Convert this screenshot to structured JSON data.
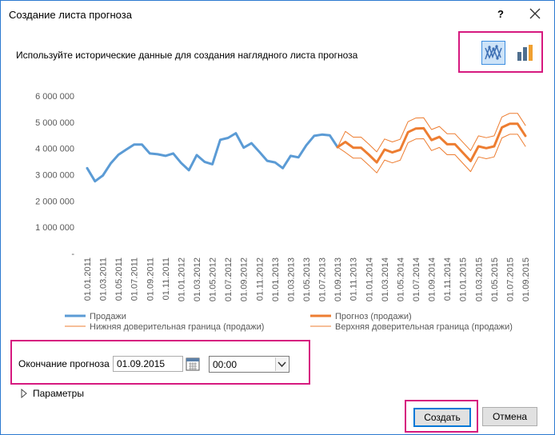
{
  "dialog": {
    "title": "Создание листа прогноза",
    "help_label": "?",
    "instruction": "Используйте исторические данные для создания наглядного листа прогноза",
    "chart_types": [
      "line-chart-icon",
      "column-chart-icon"
    ],
    "selected_chart_type": "line-chart-icon"
  },
  "forecast_end": {
    "label": "Окончание прогноза",
    "date_value": "01.09.2015",
    "time_value": "00:00"
  },
  "params": {
    "label": "Параметры"
  },
  "buttons": {
    "create": "Создать",
    "cancel": "Отмена"
  },
  "colors": {
    "actual": "#5b9bd5",
    "forecast": "#ed7d31",
    "highlight": "#d6197f",
    "accent": "#0078d7"
  },
  "chart_data": {
    "type": "line",
    "ylim": [
      0,
      6000000
    ],
    "yticks": [
      "-",
      "1 000 000",
      "2 000 000",
      "3 000 000",
      "4 000 000",
      "5 000 000",
      "6 000 000"
    ],
    "xticks": [
      "01.01.2011",
      "01.03.2011",
      "01.05.2011",
      "01.07.2011",
      "01.09.2011",
      "01.11.2011",
      "01.01.2012",
      "01.03.2012",
      "01.05.2012",
      "01.07.2012",
      "01.09.2012",
      "01.11.2012",
      "01.01.2013",
      "01.03.2013",
      "01.05.2013",
      "01.07.2013",
      "01.09.2013",
      "01.11.2013",
      "01.01.2014",
      "01.03.2014",
      "01.05.2014",
      "01.07.2014",
      "01.09.2014",
      "01.11.2014",
      "01.01.2015",
      "01.03.2015",
      "01.05.2015",
      "01.07.2015",
      "01.09.2015"
    ],
    "series": [
      {
        "name": "Продажи",
        "start": 0,
        "values": [
          3250000,
          2750000,
          2970000,
          3430000,
          3760000,
          3960000,
          4150000,
          4150000,
          3810000,
          3780000,
          3720000,
          3810000,
          3450000,
          3170000,
          3750000,
          3490000,
          3400000,
          4330000,
          4400000,
          4580000,
          4030000,
          4200000,
          3870000,
          3530000,
          3470000,
          3250000,
          3720000,
          3660000,
          4120000,
          4480000,
          4530000,
          4500000,
          4050000
        ]
      },
      {
        "name": "Прогноз (продажи)",
        "start": 32,
        "values": [
          4050000,
          4250000,
          4030000,
          4030000,
          3760000,
          3470000,
          3960000,
          3850000,
          3950000,
          4620000,
          4760000,
          4770000,
          4320000,
          4440000,
          4160000,
          4160000,
          3840000,
          3520000,
          4080000,
          4010000,
          4080000,
          4800000,
          4940000,
          4940000,
          4480000
        ]
      },
      {
        "name": "Нижняя доверительная граница (продажи)",
        "start": 32,
        "values": [
          4050000,
          3850000,
          3630000,
          3630000,
          3360000,
          3070000,
          3560000,
          3450000,
          3550000,
          4220000,
          4360000,
          4370000,
          3920000,
          4040000,
          3760000,
          3760000,
          3440000,
          3120000,
          3680000,
          3610000,
          3680000,
          4400000,
          4540000,
          4540000,
          4080000
        ]
      },
      {
        "name": "Верхняя доверительная граница (продажи)",
        "start": 32,
        "values": [
          4050000,
          4650000,
          4430000,
          4430000,
          4160000,
          3870000,
          4360000,
          4250000,
          4350000,
          5020000,
          5160000,
          5170000,
          4720000,
          4840000,
          4560000,
          4560000,
          4240000,
          3920000,
          4480000,
          4410000,
          4480000,
          5200000,
          5340000,
          5340000,
          4880000
        ]
      }
    ]
  }
}
